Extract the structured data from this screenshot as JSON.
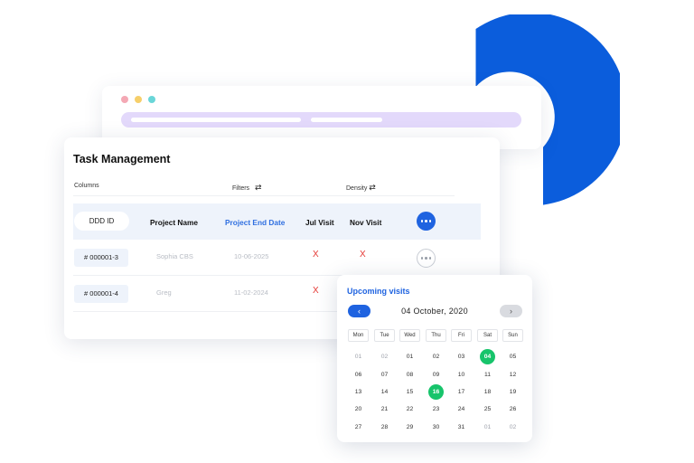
{
  "colors": {
    "accent_blue": "#1f63e0",
    "ring_blue": "#0b5ddc",
    "header_row_bg": "#eef3fb",
    "url_bar_lavender": "#e3d9fb",
    "selected_green": "#17c46b",
    "x_mark_red": "#e53935"
  },
  "browser_window": {
    "traffic_lights": [
      "red-dot",
      "yellow-dot",
      "green-dot"
    ]
  },
  "task": {
    "title": "Task Management",
    "controls": {
      "columns": "Columns",
      "filters": "Filters",
      "density": "Density",
      "swap_icon": "⇄"
    },
    "headers": {
      "id": "DDD ID",
      "project": "Project Name",
      "end_date": "Project End Date",
      "jul": "Jul Visit",
      "nov": "Nov Visit"
    },
    "rows": [
      {
        "id": "# 000001-3",
        "name": "Sophia CBS",
        "date": "10-06-2025",
        "jul": "X",
        "nov": "X"
      },
      {
        "id": "# 000001-4",
        "name": "Greg",
        "date": "11-02-2024",
        "jul": "X"
      }
    ]
  },
  "calendar": {
    "title": "Upcoming visits",
    "month_label": "04 October, 2020",
    "prev_icon": "‹",
    "next_icon": "›",
    "weekdays": [
      "Mon",
      "Tue",
      "Wed",
      "Thu",
      "Fri",
      "Sat",
      "Sun"
    ],
    "weeks": [
      [
        "01",
        "02",
        "01",
        "02",
        "03",
        "04",
        "05"
      ],
      [
        "06",
        "07",
        "08",
        "09",
        "10",
        "11",
        "12"
      ],
      [
        "13",
        "14",
        "15",
        "16",
        "17",
        "18",
        "19"
      ],
      [
        "20",
        "21",
        "22",
        "23",
        "24",
        "25",
        "26"
      ],
      [
        "27",
        "28",
        "29",
        "30",
        "31",
        "01",
        "02"
      ]
    ],
    "muted_days": [
      [
        0,
        0
      ],
      [
        0,
        1
      ],
      [
        4,
        5
      ],
      [
        4,
        6
      ]
    ],
    "selected_days": [
      [
        0,
        5
      ],
      [
        2,
        3
      ]
    ]
  }
}
